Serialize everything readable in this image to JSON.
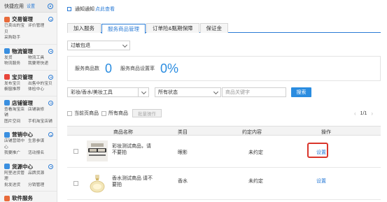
{
  "sidebar": {
    "header_title": "快捷应用",
    "header_setting": "设置",
    "groups": [
      {
        "title": "交易管理",
        "color": "#e86a3a",
        "links": [
          "已卖出的宝贝",
          "评价管理",
          "采购助手",
          ""
        ]
      },
      {
        "title": "物流管理",
        "color": "#3a8fe0",
        "links": [
          "发货",
          "物流工具",
          "物流服务",
          "我要寄快递"
        ]
      },
      {
        "title": "宝贝管理",
        "color": "#e8453a",
        "links": [
          "发布宝贝",
          "出售中的宝贝",
          "橱窗推荐",
          "体检中心"
        ]
      },
      {
        "title": "店铺管理",
        "color": "#3a8fe0",
        "links": [
          "查看淘宝店铺",
          "店铺装修",
          "图片空间",
          "手机淘宝店铺"
        ]
      },
      {
        "title": "营销中心",
        "color": "#3a8fe0",
        "links": [
          "店铺营销中心",
          "生意参谋",
          "我要推广",
          "活动报名"
        ]
      },
      {
        "title": "货源中心",
        "color": "#3a8fe0",
        "links": [
          "阿里进货管理",
          "品牌货源",
          "批发进货",
          "分销管理"
        ]
      },
      {
        "title": "软件服务",
        "color": "#e86a3a",
        "links": []
      }
    ]
  },
  "notice": {
    "text": "通知通知",
    "link": "点此查看"
  },
  "tabs": [
    {
      "label": "加入服务",
      "active": false
    },
    {
      "label": "服务商品管理",
      "active": true
    },
    {
      "label": "订单险&甄期保障",
      "active": false
    },
    {
      "label": "保证金",
      "active": false
    }
  ],
  "service_select": {
    "value": "过敏包退"
  },
  "stats": {
    "count_label": "服务商品数",
    "count_value": "0",
    "rate_label": "服务商品设置率",
    "rate_value": "0%"
  },
  "filters": {
    "category_value": "彩妆/香水/美妆工具",
    "status_value": "所有状态",
    "keyword_placeholder": "商品关键字",
    "search_label": "搜索"
  },
  "controls": {
    "current_page_label": "当前页商品",
    "all_label": "所有商品",
    "batch_label": "批量操作",
    "page_text": "1/1",
    "prev_icon": "chevron-left-icon",
    "next_icon": "chevron-right-icon"
  },
  "table": {
    "headers": {
      "name": "商品名称",
      "category": "类目",
      "agreement": "约定内容",
      "action": "操作"
    },
    "rows": [
      {
        "name": "彩妆测试商品，请不要拍",
        "category": "眼影",
        "agreement": "未约定",
        "action": "设置"
      },
      {
        "name": "香水测试商品 请不要拍",
        "category": "香水",
        "agreement": "未约定",
        "action": "设置"
      }
    ]
  },
  "colors": {
    "accent": "#2a7bd6",
    "highlight": "#d9352b",
    "stat": "#2a8ce0"
  }
}
